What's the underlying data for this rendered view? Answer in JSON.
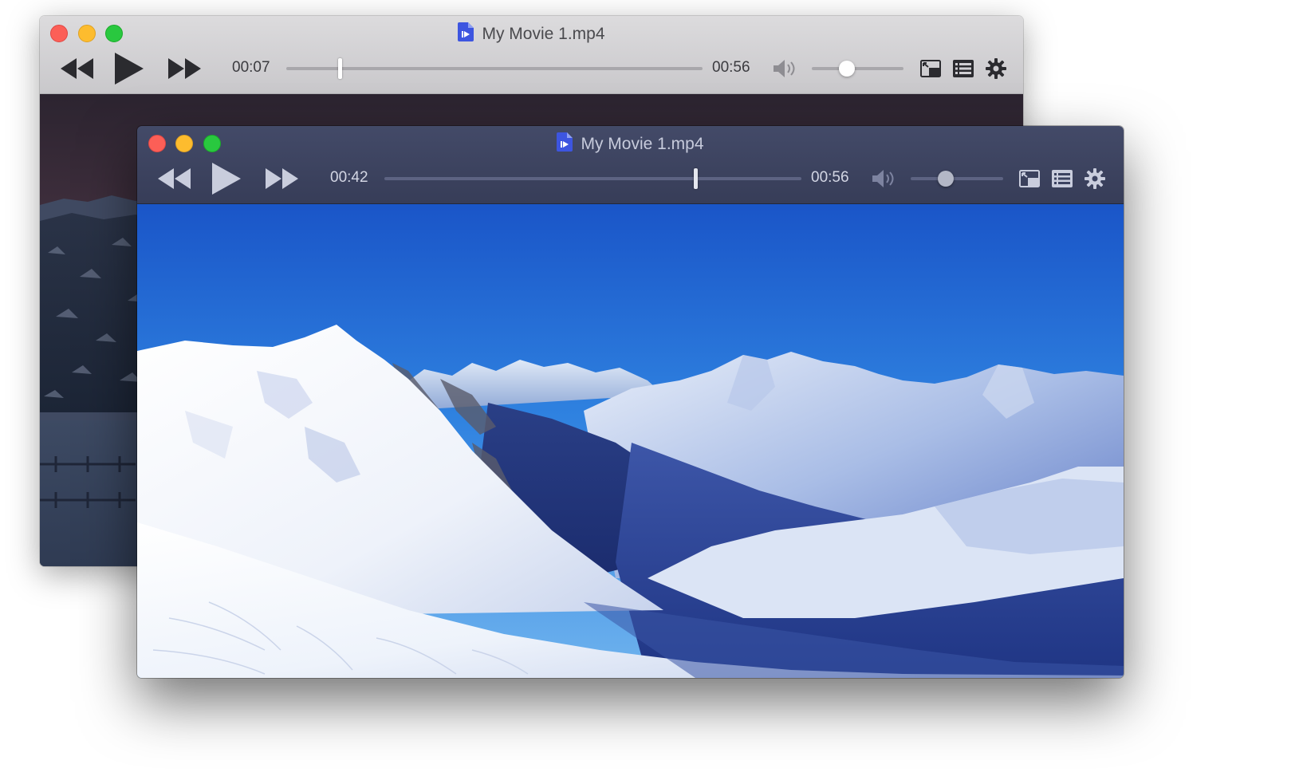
{
  "back_window": {
    "title": "My Movie 1.mp4",
    "current_time": "00:07",
    "total_time": "00:56",
    "progress": 0.125,
    "volume": 0.38
  },
  "front_window": {
    "title": "My Movie 1.mp4",
    "current_time": "00:42",
    "total_time": "00:56",
    "progress": 0.75,
    "volume": 0.38
  },
  "icons": {
    "rewind": "rewind-icon",
    "play": "play-icon",
    "fast_forward": "fast-forward-icon",
    "volume": "speaker-icon",
    "pip": "picture-in-picture-icon",
    "playlist": "playlist-icon",
    "settings": "gear-icon",
    "file": "video-file-icon"
  },
  "colors": {
    "close": "#fc5f57",
    "minimize": "#fdbc2e",
    "maximize": "#29c83f",
    "file_icon": "#3d55e0"
  }
}
